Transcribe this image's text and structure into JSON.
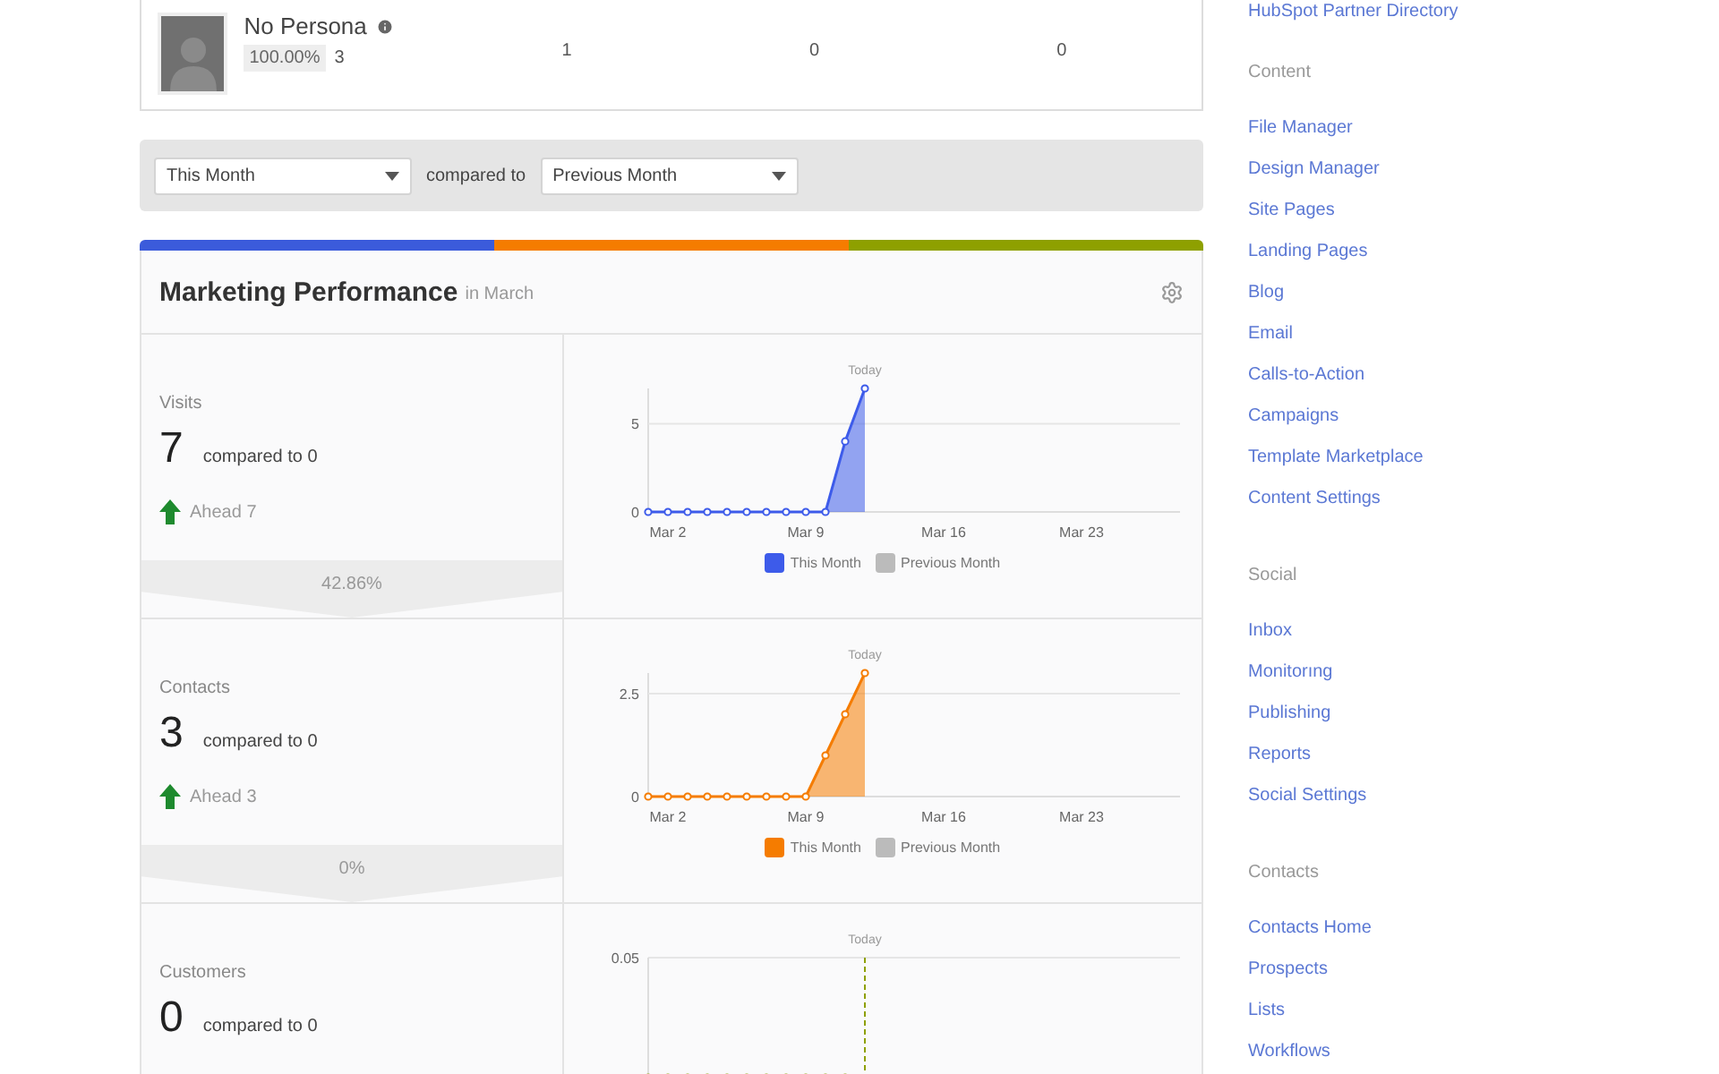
{
  "persona": {
    "name": "No Persona",
    "percent": "100.00%",
    "count": "3",
    "values": [
      "1",
      "0",
      "0"
    ]
  },
  "filters": {
    "period": "This Month",
    "compared_label": "compared to",
    "comparison": "Previous Month"
  },
  "performance": {
    "title": "Marketing Performance",
    "subtitle": "in March",
    "strip": [
      {
        "color": "#3b5bdb"
      },
      {
        "color": "#f57c00"
      },
      {
        "color": "#8ea000"
      }
    ],
    "metrics": [
      {
        "label": "Visits",
        "value": "7",
        "compared": "compared to 0",
        "ahead": "Ahead 7",
        "percent": "42.86%",
        "legend": [
          {
            "name": "This Month",
            "color": "#3d5bea"
          },
          {
            "name": "Previous Month",
            "color": "#bbbbbb"
          }
        ],
        "chart_data": {
          "type": "area",
          "categories": [
            null,
            "Mar 2",
            null,
            null,
            null,
            null,
            null,
            null,
            "Mar 9",
            null,
            null,
            null,
            null,
            null,
            null,
            "Mar 16",
            null,
            null,
            null,
            null,
            null,
            null,
            "Mar 23",
            null,
            null,
            null,
            null,
            null
          ],
          "series": [
            {
              "color": "#3d5bea",
              "values": [
                0,
                0,
                0,
                0,
                0,
                0,
                0,
                0,
                0,
                0,
                4,
                7,
                null,
                null,
                null,
                null,
                null,
                null,
                null,
                null,
                null,
                null,
                null,
                null,
                null,
                null,
                null,
                null
              ]
            }
          ],
          "ylim": [
            0,
            7
          ],
          "yticks": [
            0,
            5
          ],
          "annotations": [
            "Today"
          ]
        }
      },
      {
        "label": "Contacts",
        "value": "3",
        "compared": "compared to 0",
        "ahead": "Ahead 3",
        "percent": "0%",
        "legend": [
          {
            "name": "This Month",
            "color": "#f57c00"
          },
          {
            "name": "Previous Month",
            "color": "#bbbbbb"
          }
        ],
        "chart_data": {
          "type": "area",
          "categories": [
            null,
            "Mar 2",
            null,
            null,
            null,
            null,
            null,
            null,
            "Mar 9",
            null,
            null,
            null,
            null,
            null,
            null,
            "Mar 16",
            null,
            null,
            null,
            null,
            null,
            null,
            "Mar 23",
            null,
            null,
            null,
            null,
            null
          ],
          "series": [
            {
              "color": "#f57c00",
              "values": [
                0,
                0,
                0,
                0,
                0,
                0,
                0,
                0,
                0,
                1,
                2,
                3,
                null,
                null,
                null,
                null,
                null,
                null,
                null,
                null,
                null,
                null,
                null,
                null,
                null,
                null,
                null,
                null
              ]
            }
          ],
          "ylim": [
            0,
            3
          ],
          "yticks": [
            0,
            2.5
          ],
          "annotations": [
            "Today"
          ]
        }
      },
      {
        "label": "Customers",
        "value": "0",
        "compared": "compared to 0",
        "chart": {
          "today_label": "Today",
          "top_tick": "0.05",
          "color": "#8ea000"
        }
      }
    ]
  },
  "sidebar": {
    "top_link": "HubSpot Partner Directory",
    "sections": [
      {
        "heading": "Content",
        "items": [
          "File Manager",
          "Design Manager",
          "Site Pages",
          "Landing Pages",
          "Blog",
          "Email",
          "Calls-to-Action",
          "Campaigns",
          "Template Marketplace",
          "Content Settings"
        ]
      },
      {
        "heading": "Social",
        "items": [
          "Inbox",
          "Monitorıng",
          "Publishing",
          "Reports",
          "Social Settings"
        ]
      },
      {
        "heading": "Contacts",
        "items": [
          "Contacts Home",
          "Prospects",
          "Lists",
          "Workflows"
        ]
      }
    ]
  }
}
